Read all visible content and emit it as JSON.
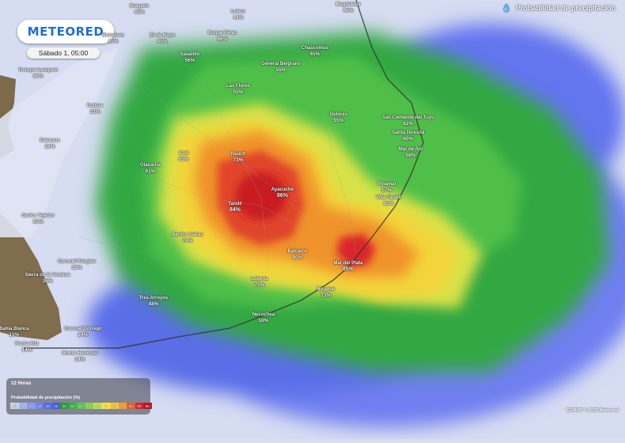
{
  "header": {
    "layer_title": "Probabilidad de precipitación",
    "layer_icon": "raindrop-icon"
  },
  "brand": {
    "logo_text": "METEORED"
  },
  "time": {
    "label": "Sábado 1, 05:00"
  },
  "legend": {
    "hour": "12 Horas",
    "title": "Probabilidad de precipitación (%)",
    "steps": [
      {
        "v": "15",
        "c": "#c9d4ee"
      },
      {
        "v": "20",
        "c": "#a9b6ee"
      },
      {
        "v": "25",
        "c": "#8d9bef"
      },
      {
        "v": "30",
        "c": "#7283ee"
      },
      {
        "v": "35",
        "c": "#5a6cf0"
      },
      {
        "v": "40",
        "c": "#4a5de0"
      },
      {
        "v": "45",
        "c": "#2f9e3c"
      },
      {
        "v": "50",
        "c": "#3bb447"
      },
      {
        "v": "55",
        "c": "#5cc84e"
      },
      {
        "v": "60",
        "c": "#8ad450"
      },
      {
        "v": "65",
        "c": "#c0e04c"
      },
      {
        "v": "70",
        "c": "#f3e83e"
      },
      {
        "v": "75",
        "c": "#f7c733"
      },
      {
        "v": "80",
        "c": "#f29f2a"
      },
      {
        "v": "85",
        "c": "#e8602a"
      },
      {
        "v": "90",
        "c": "#d9262a"
      },
      {
        "v": "95",
        "c": "#b8181e"
      }
    ]
  },
  "credit": "ECMWF © 2025 Meteored",
  "places": [
    {
      "name": "Brandsen",
      "value": "45%"
    },
    {
      "name": "Lobos",
      "value": "44%"
    },
    {
      "name": "Magdalena",
      "value": "46%"
    },
    {
      "name": "Bragado",
      "value": "45%"
    },
    {
      "name": "25 de Mayo",
      "value": "45%"
    },
    {
      "name": "Roque Pérez",
      "value": "46%"
    },
    {
      "name": "Chascomús",
      "value": "45%"
    },
    {
      "name": "Saladillo",
      "value": "56%"
    },
    {
      "name": "General Belgrano",
      "value": "55%"
    },
    {
      "name": "Las Flores",
      "value": "55%"
    },
    {
      "name": "Bolívar",
      "value": "33%"
    },
    {
      "name": "Dolores",
      "value": "55%"
    },
    {
      "name": "San Clemente del Tuyú",
      "value": "62%"
    },
    {
      "name": "Santa Teresita",
      "value": "60%"
    },
    {
      "name": "Mar de Ajó",
      "value": "58%"
    },
    {
      "name": "Trenque Lauquen",
      "value": "36%"
    },
    {
      "name": "Azul",
      "value": "65%"
    },
    {
      "name": "Rauch",
      "value": "73%"
    },
    {
      "name": "Olavarría",
      "value": "61%"
    },
    {
      "name": "Daireaux",
      "value": "28%"
    },
    {
      "name": "Ayacucho",
      "value": "86%"
    },
    {
      "name": "Pinamar",
      "value": "57%"
    },
    {
      "name": "Tandil",
      "value": "84%"
    },
    {
      "name": "Villa Gesell",
      "value": "61%"
    },
    {
      "name": "Carlos Tejedor",
      "value": "25%"
    },
    {
      "name": "Benito Juárez",
      "value": "74%"
    },
    {
      "name": "Balcarce",
      "value": "80%"
    },
    {
      "name": "Mar del Plata",
      "value": "85%"
    },
    {
      "name": "Coronel Pringles",
      "value": "38%"
    },
    {
      "name": "Sierra de la Ventana",
      "value": "36%"
    },
    {
      "name": "Lobería",
      "value": "73%"
    },
    {
      "name": "Miramar",
      "value": "73%"
    },
    {
      "name": "Tres Arroyos",
      "value": "48%"
    },
    {
      "name": "Necochea",
      "value": "59%"
    },
    {
      "name": "Bahía Blanca",
      "value": "15%"
    },
    {
      "name": "Coronel Dorrego",
      "value": "24%"
    },
    {
      "name": "Punta Alta",
      "value": "14%"
    },
    {
      "name": "Monte Hermoso",
      "value": "24%"
    }
  ]
}
